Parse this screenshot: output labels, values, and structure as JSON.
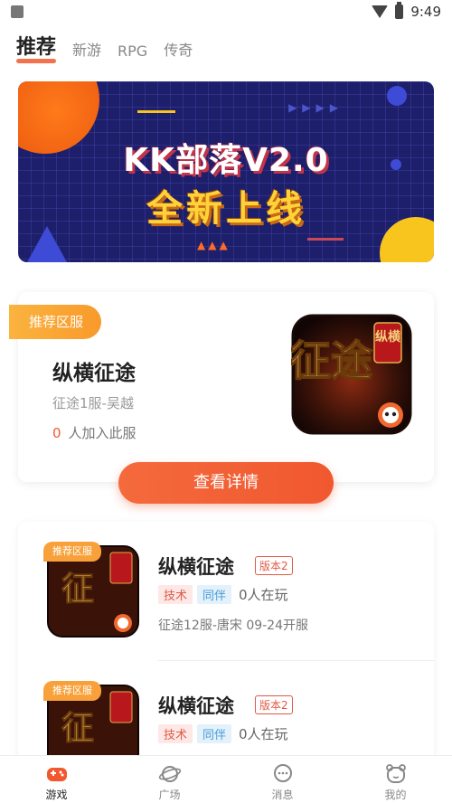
{
  "status_bar": {
    "time": "9:49"
  },
  "top_tabs": [
    {
      "label": "推荐",
      "active": true
    },
    {
      "label": "新游",
      "active": false
    },
    {
      "label": "RPG",
      "active": false
    },
    {
      "label": "传奇",
      "active": false
    }
  ],
  "banner": {
    "title": "KK部落V2.0",
    "subtitle": "全新上线"
  },
  "featured": {
    "ribbon": "推荐区服",
    "game_name": "纵横征途",
    "server": "征途1服-吴越",
    "join_count": "0",
    "join_text": "人加入此服",
    "detail_button": "查看详情",
    "icon_text_main": "征途",
    "icon_text_side": "纵横"
  },
  "list": [
    {
      "tag": "推荐区服",
      "name": "纵横征途",
      "version": "版本2",
      "chips": [
        "技术",
        "同伴"
      ],
      "online": "0人在玩",
      "server": "征途12服-唐宋 09-24开服"
    },
    {
      "tag": "推荐区服",
      "name": "纵横征途",
      "version": "版本2",
      "chips": [
        "技术",
        "同伴"
      ],
      "online": "0人在玩",
      "server": ""
    }
  ],
  "bottom_nav": [
    {
      "label": "游戏",
      "icon": "gamepad-icon",
      "active": true
    },
    {
      "label": "广场",
      "icon": "planet-icon",
      "active": false
    },
    {
      "label": "消息",
      "icon": "message-icon",
      "active": false
    },
    {
      "label": "我的",
      "icon": "profile-icon",
      "active": false
    }
  ],
  "colors": {
    "accent": "#f1582f",
    "ribbon": "#f8a13a",
    "banner_bg": "#1d1f6b"
  }
}
